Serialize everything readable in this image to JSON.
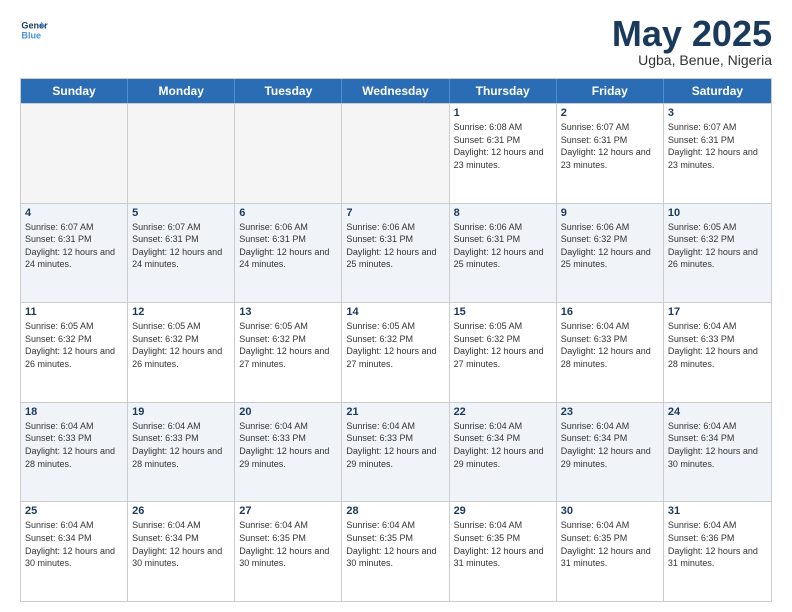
{
  "logo": {
    "line1": "General",
    "line2": "Blue"
  },
  "title": "May 2025",
  "subtitle": "Ugba, Benue, Nigeria",
  "header": {
    "days": [
      "Sunday",
      "Monday",
      "Tuesday",
      "Wednesday",
      "Thursday",
      "Friday",
      "Saturday"
    ]
  },
  "weeks": [
    [
      {
        "day": "",
        "empty": true
      },
      {
        "day": "",
        "empty": true
      },
      {
        "day": "",
        "empty": true
      },
      {
        "day": "",
        "empty": true
      },
      {
        "day": "1",
        "sunrise": "6:08 AM",
        "sunset": "6:31 PM",
        "daylight": "12 hours and 23 minutes."
      },
      {
        "day": "2",
        "sunrise": "6:07 AM",
        "sunset": "6:31 PM",
        "daylight": "12 hours and 23 minutes."
      },
      {
        "day": "3",
        "sunrise": "6:07 AM",
        "sunset": "6:31 PM",
        "daylight": "12 hours and 23 minutes."
      }
    ],
    [
      {
        "day": "4",
        "sunrise": "6:07 AM",
        "sunset": "6:31 PM",
        "daylight": "12 hours and 24 minutes."
      },
      {
        "day": "5",
        "sunrise": "6:07 AM",
        "sunset": "6:31 PM",
        "daylight": "12 hours and 24 minutes."
      },
      {
        "day": "6",
        "sunrise": "6:06 AM",
        "sunset": "6:31 PM",
        "daylight": "12 hours and 24 minutes."
      },
      {
        "day": "7",
        "sunrise": "6:06 AM",
        "sunset": "6:31 PM",
        "daylight": "12 hours and 25 minutes."
      },
      {
        "day": "8",
        "sunrise": "6:06 AM",
        "sunset": "6:31 PM",
        "daylight": "12 hours and 25 minutes."
      },
      {
        "day": "9",
        "sunrise": "6:06 AM",
        "sunset": "6:32 PM",
        "daylight": "12 hours and 25 minutes."
      },
      {
        "day": "10",
        "sunrise": "6:05 AM",
        "sunset": "6:32 PM",
        "daylight": "12 hours and 26 minutes."
      }
    ],
    [
      {
        "day": "11",
        "sunrise": "6:05 AM",
        "sunset": "6:32 PM",
        "daylight": "12 hours and 26 minutes."
      },
      {
        "day": "12",
        "sunrise": "6:05 AM",
        "sunset": "6:32 PM",
        "daylight": "12 hours and 26 minutes."
      },
      {
        "day": "13",
        "sunrise": "6:05 AM",
        "sunset": "6:32 PM",
        "daylight": "12 hours and 27 minutes."
      },
      {
        "day": "14",
        "sunrise": "6:05 AM",
        "sunset": "6:32 PM",
        "daylight": "12 hours and 27 minutes."
      },
      {
        "day": "15",
        "sunrise": "6:05 AM",
        "sunset": "6:32 PM",
        "daylight": "12 hours and 27 minutes."
      },
      {
        "day": "16",
        "sunrise": "6:04 AM",
        "sunset": "6:33 PM",
        "daylight": "12 hours and 28 minutes."
      },
      {
        "day": "17",
        "sunrise": "6:04 AM",
        "sunset": "6:33 PM",
        "daylight": "12 hours and 28 minutes."
      }
    ],
    [
      {
        "day": "18",
        "sunrise": "6:04 AM",
        "sunset": "6:33 PM",
        "daylight": "12 hours and 28 minutes."
      },
      {
        "day": "19",
        "sunrise": "6:04 AM",
        "sunset": "6:33 PM",
        "daylight": "12 hours and 28 minutes."
      },
      {
        "day": "20",
        "sunrise": "6:04 AM",
        "sunset": "6:33 PM",
        "daylight": "12 hours and 29 minutes."
      },
      {
        "day": "21",
        "sunrise": "6:04 AM",
        "sunset": "6:33 PM",
        "daylight": "12 hours and 29 minutes."
      },
      {
        "day": "22",
        "sunrise": "6:04 AM",
        "sunset": "6:34 PM",
        "daylight": "12 hours and 29 minutes."
      },
      {
        "day": "23",
        "sunrise": "6:04 AM",
        "sunset": "6:34 PM",
        "daylight": "12 hours and 29 minutes."
      },
      {
        "day": "24",
        "sunrise": "6:04 AM",
        "sunset": "6:34 PM",
        "daylight": "12 hours and 30 minutes."
      }
    ],
    [
      {
        "day": "25",
        "sunrise": "6:04 AM",
        "sunset": "6:34 PM",
        "daylight": "12 hours and 30 minutes."
      },
      {
        "day": "26",
        "sunrise": "6:04 AM",
        "sunset": "6:34 PM",
        "daylight": "12 hours and 30 minutes."
      },
      {
        "day": "27",
        "sunrise": "6:04 AM",
        "sunset": "6:35 PM",
        "daylight": "12 hours and 30 minutes."
      },
      {
        "day": "28",
        "sunrise": "6:04 AM",
        "sunset": "6:35 PM",
        "daylight": "12 hours and 30 minutes."
      },
      {
        "day": "29",
        "sunrise": "6:04 AM",
        "sunset": "6:35 PM",
        "daylight": "12 hours and 31 minutes."
      },
      {
        "day": "30",
        "sunrise": "6:04 AM",
        "sunset": "6:35 PM",
        "daylight": "12 hours and 31 minutes."
      },
      {
        "day": "31",
        "sunrise": "6:04 AM",
        "sunset": "6:36 PM",
        "daylight": "12 hours and 31 minutes."
      }
    ]
  ]
}
